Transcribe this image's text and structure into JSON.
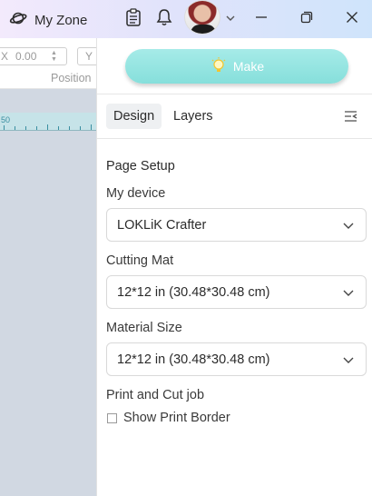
{
  "titlebar": {
    "zone_label": "My Zone",
    "icons": [
      "planet-icon",
      "clipboard-icon",
      "bell-icon",
      "avatar",
      "chevron-down-icon",
      "minimize-icon",
      "restore-icon",
      "close-icon"
    ]
  },
  "toolbar": {
    "position_x_prefix": "X",
    "position_x_value": "0.00",
    "position_y_prefix": "Y",
    "position_label": "Position"
  },
  "ruler": {
    "label": "50"
  },
  "make": {
    "label": "Make",
    "color": "#8fe3df"
  },
  "tabs": [
    {
      "label": "Design",
      "active": true
    },
    {
      "label": "Layers",
      "active": false
    }
  ],
  "design": {
    "page_setup_title": "Page Setup",
    "device_label": "My device",
    "device_value": "LOKLiK Crafter",
    "mat_label": "Cutting Mat",
    "mat_value": "12*12 in (30.48*30.48 cm)",
    "material_label": "Material Size",
    "material_value": "12*12 in (30.48*30.48 cm)",
    "print_cut_label": "Print and Cut job",
    "show_border_label": "Show Print Border",
    "show_border_checked": false
  },
  "colors": {
    "accent": "#8fe3df",
    "canvas_bg": "#d1d8e2",
    "ruler_bg": "#c6e3e8"
  }
}
